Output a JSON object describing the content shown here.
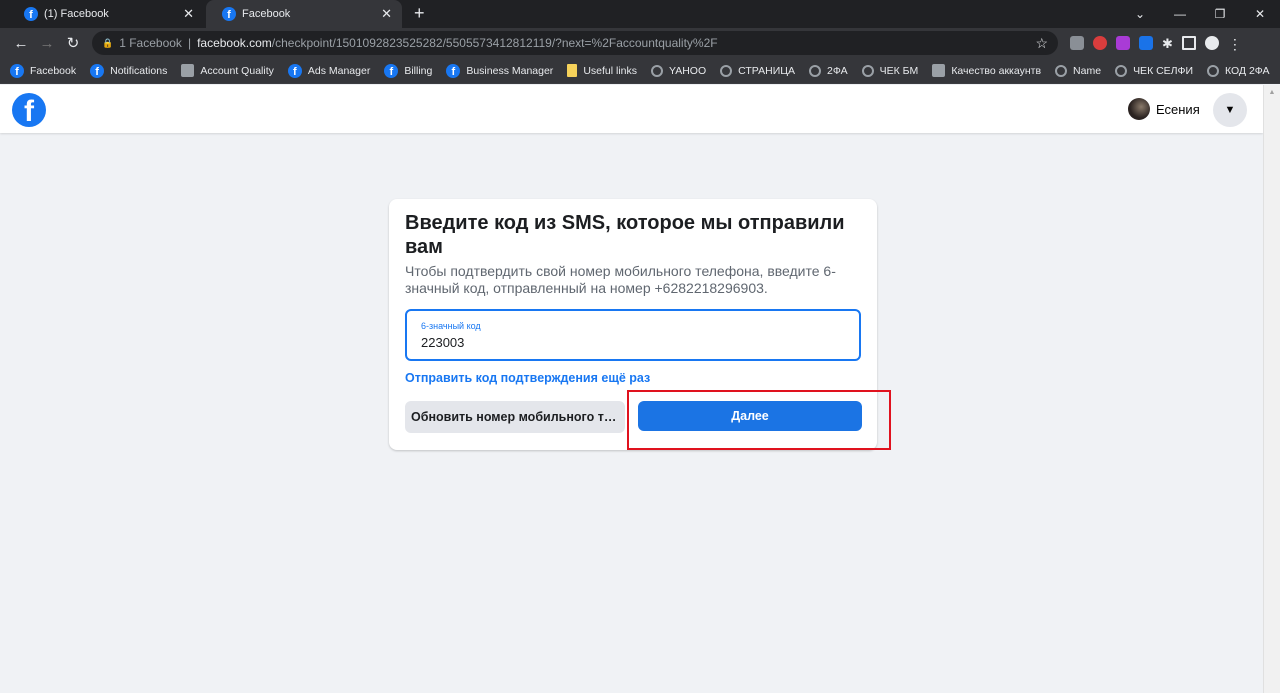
{
  "browser": {
    "tabs": [
      {
        "title": "(1) Facebook",
        "active": false
      },
      {
        "title": "Facebook",
        "active": true
      }
    ],
    "address": {
      "page_title": "1 Facebook",
      "host": "facebook.com",
      "path": "/checkpoint/1501092823525282/5505573412812119/?next=%2Faccountquality%2F"
    },
    "bookmarks": [
      {
        "label": "Facebook",
        "icon": "facebook-icon"
      },
      {
        "label": "Notifications",
        "icon": "facebook-icon"
      },
      {
        "label": "Account Quality",
        "icon": "document-icon"
      },
      {
        "label": "Ads Manager",
        "icon": "facebook-icon"
      },
      {
        "label": "Billing",
        "icon": "facebook-icon"
      },
      {
        "label": "Business Manager",
        "icon": "facebook-icon"
      },
      {
        "label": "Useful links",
        "icon": "folder-icon"
      },
      {
        "label": "YAHOO",
        "icon": "globe-icon"
      },
      {
        "label": "СТРАНИЦА",
        "icon": "globe-icon"
      },
      {
        "label": "2ФА",
        "icon": "globe-icon"
      },
      {
        "label": "ЧЕК БМ",
        "icon": "globe-icon"
      },
      {
        "label": "Качество аккаунтв",
        "icon": "document-icon"
      },
      {
        "label": "Name",
        "icon": "globe-icon"
      },
      {
        "label": "ЧЕК СЕЛФИ",
        "icon": "globe-icon"
      },
      {
        "label": "КОД 2ФА",
        "icon": "globe-icon"
      }
    ],
    "more": "»"
  },
  "header": {
    "user_name": "Есения"
  },
  "dialog": {
    "title": "Введите код из SMS, которое мы отправили вам",
    "description": "Чтобы подтвердить свой номер мобильного телефона, введите 6-значный код, отправленный на номер +6282218296903.",
    "code_label": "6-значный код",
    "code_value": "223003",
    "resend_link": "Отправить код подтверждения ещё раз",
    "update_button": "Обновить номер мобильного телефона",
    "next_button": "Далее"
  },
  "colors": {
    "accent": "#1877f2",
    "highlight": "#e0121e",
    "background": "#f0f2f5"
  }
}
